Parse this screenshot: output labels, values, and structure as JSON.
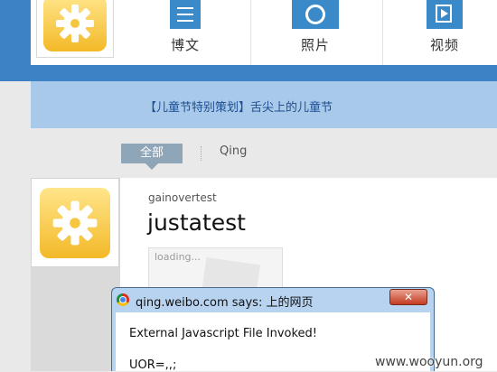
{
  "header": {
    "nav": [
      {
        "label": "博文",
        "icon": "menu-icon"
      },
      {
        "label": "照片",
        "icon": "camera-icon"
      },
      {
        "label": "视频",
        "icon": "play-icon"
      }
    ],
    "avatar_icon": "gear-icon"
  },
  "banner": {
    "text": "【儿童节特别策划】舌尖上的儿童节"
  },
  "tabs": {
    "all": "全部",
    "qing": "Qing"
  },
  "post": {
    "username": "gainovertest",
    "title": "justatest",
    "image_status": "loading...",
    "avatar_icon": "gear-icon"
  },
  "dialog": {
    "title": "qing.weibo.com says: 上的网页",
    "message": "External Javascript File Invoked!",
    "detail": "UOR=,,;",
    "close_label": "✕"
  },
  "watermark": "www.wooyun.org",
  "colors": {
    "header_blue": "#3d82c4",
    "banner": "#a9c9ea",
    "banner_text": "#1d4f91",
    "tab": "#8fa6b8"
  }
}
